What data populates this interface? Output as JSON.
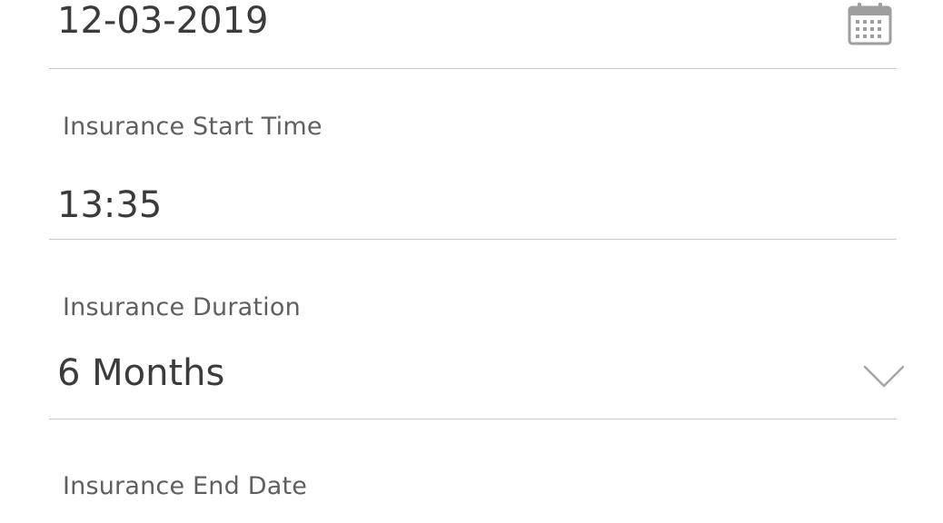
{
  "start_date": {
    "value": "12-03-2019",
    "icon": "calendar-icon"
  },
  "start_time": {
    "label": "Insurance Start Time",
    "value": "13:35"
  },
  "duration": {
    "label": "Insurance Duration",
    "value": "6 Months",
    "icon": "chevron-down-icon"
  },
  "end_date": {
    "label": "Insurance End Date"
  },
  "colors": {
    "underline": "#c8c8c8",
    "label": "#5f5f5f",
    "value": "#3b3b3b",
    "icon": "#9e9e9e"
  }
}
